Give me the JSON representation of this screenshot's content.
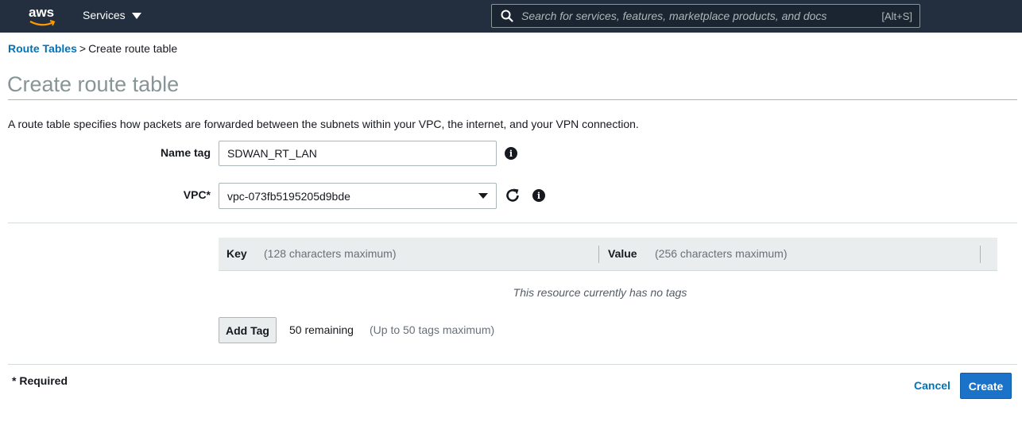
{
  "topbar": {
    "logo_text": "aws",
    "services_label": "Services",
    "search_placeholder": "Search for services, features, marketplace products, and docs",
    "search_shortcut": "[Alt+S]"
  },
  "breadcrumb": {
    "parent": "Route Tables",
    "separator": ">",
    "current": "Create route table"
  },
  "page": {
    "title": "Create route table",
    "description": "A route table specifies how packets are forwarded between the subnets within your VPC, the internet, and your VPN connection."
  },
  "form": {
    "name_tag_label": "Name tag",
    "name_tag_value": "SDWAN_RT_LAN",
    "vpc_label": "VPC*",
    "vpc_value": "vpc-073fb5195205d9bde"
  },
  "tags": {
    "key_header": "Key",
    "key_hint": "(128 characters maximum)",
    "value_header": "Value",
    "value_hint": "(256 characters maximum)",
    "empty_message": "This resource currently has no tags",
    "add_tag_label": "Add Tag",
    "remaining": "50 remaining",
    "max_hint": "(Up to 50 tags maximum)"
  },
  "footer": {
    "required_note": "* Required",
    "cancel_label": "Cancel",
    "create_label": "Create"
  },
  "colors": {
    "topbar": "#232f3e",
    "link": "#0073bb",
    "primary_button": "#1a73c8"
  },
  "icons": [
    "aws-logo-icon",
    "caret-down-icon",
    "search-icon",
    "info-icon",
    "refresh-icon"
  ]
}
